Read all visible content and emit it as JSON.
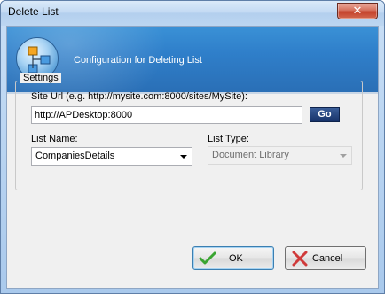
{
  "window": {
    "title": "Delete List",
    "close_glyph": "✕"
  },
  "header": {
    "text": "Configuration for Deleting List",
    "icon": "list-hierarchy-icon"
  },
  "settings": {
    "legend": "Settings",
    "site_url_label": "Site Url (e.g. http://mysite.com:8000/sites/MySite):",
    "site_url_value": "http://APDesktop:8000",
    "go_label": "Go",
    "list_name_label": "List Name:",
    "list_name_value": "CompaniesDetails",
    "list_type_label": "List Type:",
    "list_type_value": "Document Library"
  },
  "buttons": {
    "ok_label": "OK",
    "cancel_label": "Cancel"
  },
  "colors": {
    "header_blue": "#2f7fca",
    "go_button": "#17336a",
    "ok_check": "#3aa531",
    "cancel_x": "#d03a3a"
  }
}
